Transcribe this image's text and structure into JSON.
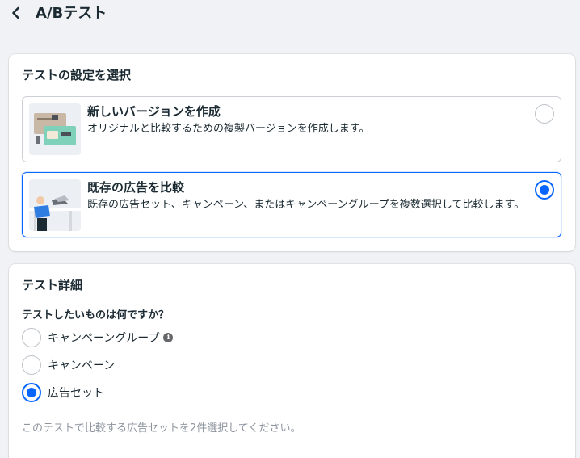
{
  "header": {
    "title": "A/Bテスト",
    "back_icon": "chevron-left-icon"
  },
  "settings": {
    "title": "テストの設定を選択",
    "options": [
      {
        "title": "新しいバージョンを作成",
        "description": "オリジナルと比較するための複製バージョンを作成します。",
        "selected": false
      },
      {
        "title": "既存の広告を比較",
        "description": "既存の広告セット、キャンペーン、またはキャンペーングループを複数選択して比較します。",
        "selected": true
      }
    ]
  },
  "details": {
    "title": "テスト詳細",
    "question": "テストしたいものは何ですか？",
    "choices": [
      {
        "label": "キャンペーングループ",
        "selected": false,
        "has_info_icon": true
      },
      {
        "label": "キャンペーン",
        "selected": false
      },
      {
        "label": "広告セット",
        "selected": true
      }
    ],
    "helper": "このテストで比較する広告セットを2件選択してください。"
  },
  "colors": {
    "accent": "#0866ff",
    "background": "#f0f2f5",
    "text": "#1c2b33",
    "muted": "#8d949e"
  }
}
